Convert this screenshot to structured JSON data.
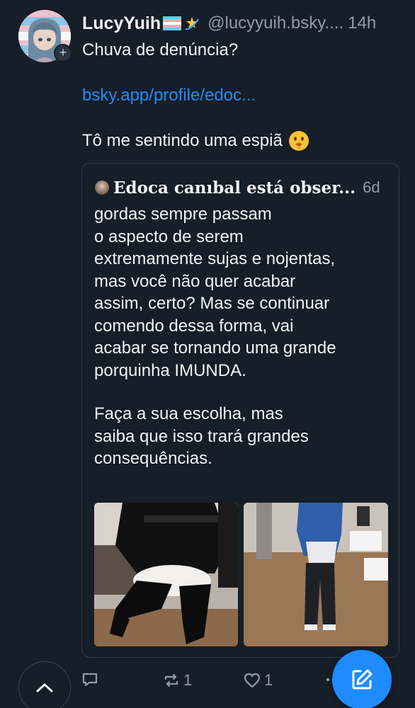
{
  "post": {
    "author": {
      "display_name": "LucyYuih",
      "name_emojis": [
        "transgender-flag-icon",
        "dizzy-star-icon"
      ],
      "handle": "@lucyyuih.bsky....",
      "time": "14h",
      "avatar_badge": "+"
    },
    "text_line1": "Chuva de denúncia?",
    "link": "bsky.app/profile/edoc...",
    "text_line3": "Tô me sentindo uma espiã",
    "text_emoji": "shushing-face-icon"
  },
  "quote": {
    "author_name": "Edoca canıbal está obser...",
    "time": "6d",
    "paragraph1_lines": [
      "gordas sempre passam",
      "o aspecto de serem",
      "extremamente sujas e nojentas,",
      "mas você não quer acabar",
      "assim, certo? Mas se continuar",
      "comendo dessa forma, vai",
      "acabar se tornando uma grande",
      "porquinha IMUNDA."
    ],
    "paragraph2_lines": [
      "Faça a sua escolha, mas",
      "saiba que isso trará grandes",
      "consequências."
    ],
    "images": [
      "photo-1",
      "photo-2"
    ]
  },
  "actions": {
    "reply_count": "",
    "repost_count": "1",
    "like_count": "1"
  },
  "colors": {
    "background": "#161e27",
    "accent": "#1e8cff",
    "muted": "#8f9cab",
    "text": "#f1f3f5"
  }
}
